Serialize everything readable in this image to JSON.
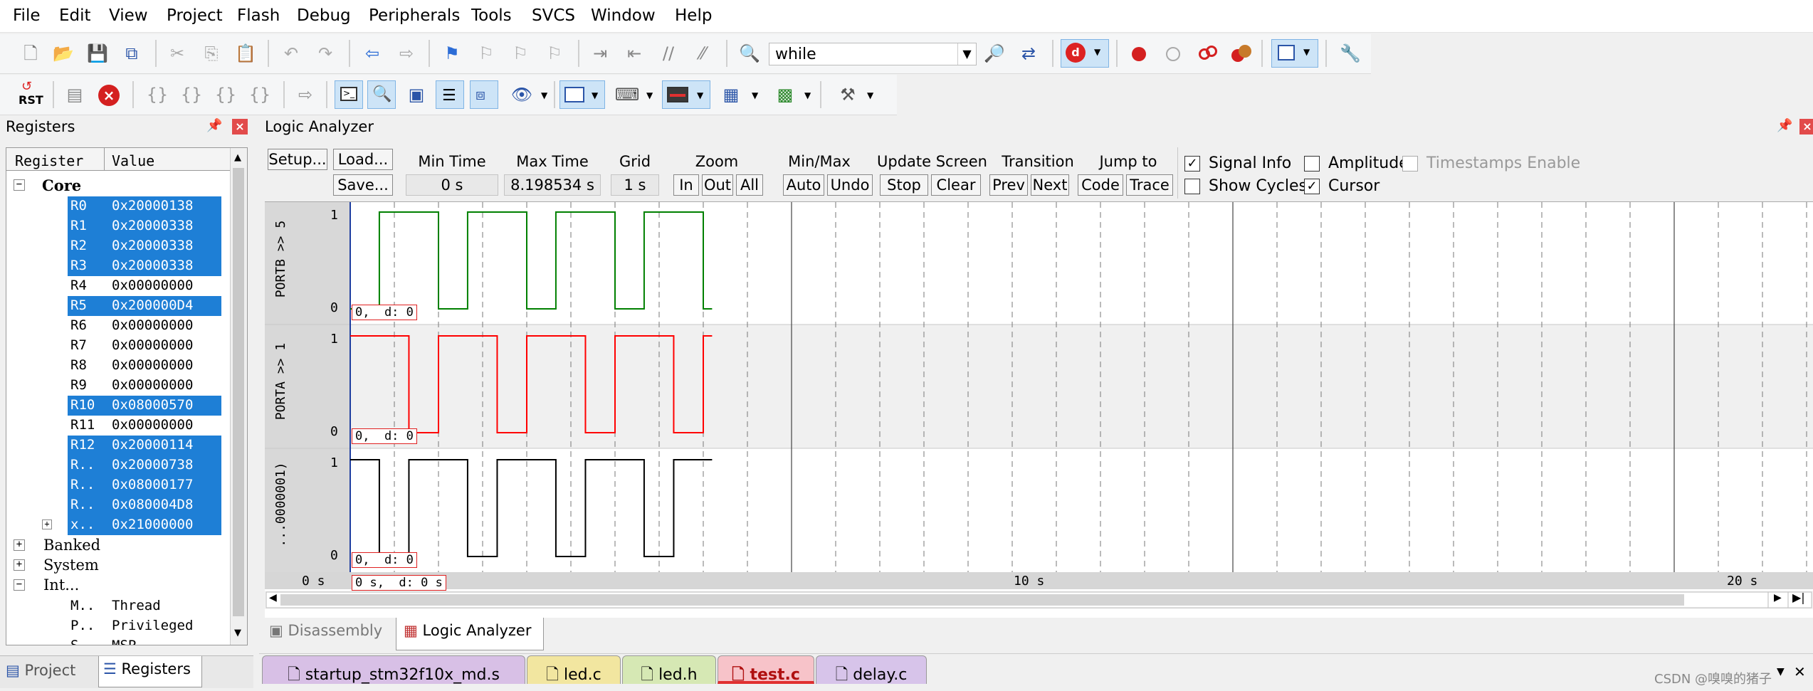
{
  "menu": [
    "File",
    "Edit",
    "View",
    "Project",
    "Flash",
    "Debug",
    "Peripherals",
    "Tools",
    "SVCS",
    "Window",
    "Help"
  ],
  "toolbar": {
    "find_text": "while",
    "rst_label": "RST"
  },
  "registers_panel": {
    "title": "Registers",
    "col_register": "Register",
    "col_value": "Value",
    "core_label": "Core",
    "rows": [
      {
        "name": "R0",
        "value": "0x20000138",
        "hl": true
      },
      {
        "name": "R1",
        "value": "0x20000338",
        "hl": true
      },
      {
        "name": "R2",
        "value": "0x20000338",
        "hl": true
      },
      {
        "name": "R3",
        "value": "0x20000338",
        "hl": true
      },
      {
        "name": "R4",
        "value": "0x00000000",
        "hl": false
      },
      {
        "name": "R5",
        "value": "0x200000D4",
        "hl": true
      },
      {
        "name": "R6",
        "value": "0x00000000",
        "hl": false
      },
      {
        "name": "R7",
        "value": "0x00000000",
        "hl": false
      },
      {
        "name": "R8",
        "value": "0x00000000",
        "hl": false
      },
      {
        "name": "R9",
        "value": "0x00000000",
        "hl": false
      },
      {
        "name": "R10",
        "value": "0x08000570",
        "hl": true
      },
      {
        "name": "R11",
        "value": "0x00000000",
        "hl": false
      },
      {
        "name": "R12",
        "value": "0x20000114",
        "hl": true
      },
      {
        "name": "R..",
        "value": "0x20000738",
        "hl": true
      },
      {
        "name": "R..",
        "value": "0x08000177",
        "hl": true
      },
      {
        "name": "R..",
        "value": "0x080004D8",
        "hl": true
      },
      {
        "name": "x..",
        "value": "0x21000000",
        "hl": true
      }
    ],
    "groups": [
      "Banked",
      "System",
      "Int..."
    ],
    "int_rows": [
      {
        "name": "M..",
        "value": "Thread"
      },
      {
        "name": "P..",
        "value": "Privileged"
      },
      {
        "name": "S..",
        "value": "MSP"
      }
    ],
    "tab_project": "Project",
    "tab_registers": "Registers"
  },
  "logic_analyzer": {
    "title": "Logic Analyzer",
    "setup": "Setup...",
    "load": "Load...",
    "save": "Save...",
    "min_time_label": "Min Time",
    "min_time_value": "0 s",
    "max_time_label": "Max Time",
    "max_time_value": "8.198534 s",
    "grid_label": "Grid",
    "grid_value": "1 s",
    "zoom_label": "Zoom",
    "zoom_in": "In",
    "zoom_out": "Out",
    "zoom_all": "All",
    "minmax_label": "Min/Max",
    "minmax_auto": "Auto",
    "minmax_undo": "Undo",
    "update_label": "Update Screen",
    "update_stop": "Stop",
    "update_clear": "Clear",
    "transition_label": "Transition",
    "transition_prev": "Prev",
    "transition_next": "Next",
    "jump_label": "Jump to",
    "jump_code": "Code",
    "jump_trace": "Trace",
    "signal_info": "Signal Info",
    "show_cycles": "Show Cycles",
    "amplitude": "Amplitude",
    "cursor": "Cursor",
    "timestamps": "Timestamps Enable",
    "signal_info_checked": true,
    "show_cycles_checked": false,
    "amplitude_checked": false,
    "cursor_checked": true,
    "timestamps_checked": false,
    "signals": [
      {
        "name": "PORTB >> 5",
        "color": "#008000",
        "y1": "1",
        "y0": "0",
        "info": "0,  d: 0"
      },
      {
        "name": "PORTA >> 1",
        "color": "#ff0000",
        "y1": "1",
        "y0": "0",
        "info": "0,  d: 0"
      },
      {
        "name": "...0000001)",
        "color": "#000000",
        "y1": "1",
        "y0": "0",
        "info": "0,  d: 0"
      }
    ],
    "time_axis": [
      "0 s",
      "10 s",
      "20 s"
    ],
    "cursor_readout": "0 s,  d: 0 s"
  },
  "bottom_tabs": {
    "disassembly": "Disassembly",
    "logic_analyzer": "Logic Analyzer"
  },
  "file_tabs": [
    {
      "name": "startup_stm32f10x_md.s",
      "color": "#d8c0e6"
    },
    {
      "name": "led.c",
      "color": "#f2e6a0"
    },
    {
      "name": "led.h",
      "color": "#d6e8b4"
    },
    {
      "name": "test.c",
      "color": "#f7c3c9"
    },
    {
      "name": "delay.c",
      "color": "#d7c4ea"
    }
  ],
  "watermark": "CSDN @嗅嗅的猪子"
}
